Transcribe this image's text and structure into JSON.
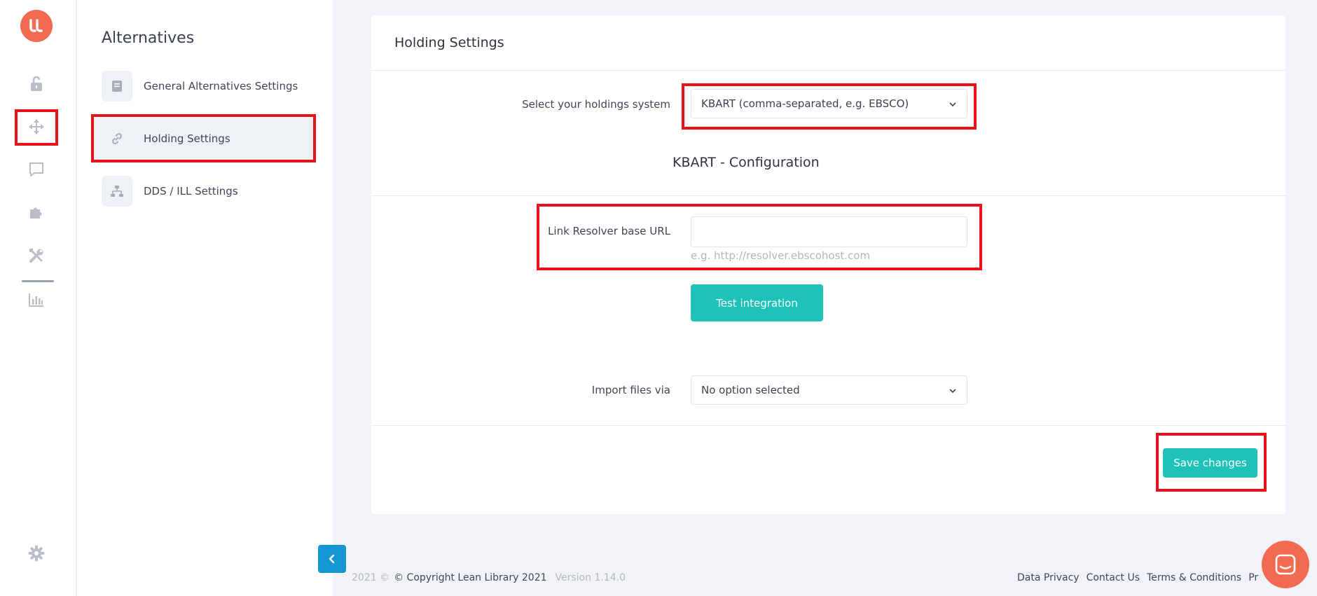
{
  "rail": {
    "logo_text": "LL",
    "items": [
      {
        "icon": "unlock-icon"
      },
      {
        "icon": "move-arrows-icon"
      },
      {
        "icon": "chat-bubble-icon"
      },
      {
        "icon": "puzzle-icon"
      },
      {
        "icon": "tools-icon"
      },
      {
        "icon": "bar-chart-icon"
      },
      {
        "icon": "gear-icon"
      }
    ]
  },
  "subnav": {
    "title": "Alternatives",
    "items": [
      {
        "label": "General Alternatives Settings",
        "icon": "book-icon"
      },
      {
        "label": "Holding Settings",
        "icon": "link-icon",
        "active": true
      },
      {
        "label": "DDS / ILL Settings",
        "icon": "sitemap-icon"
      }
    ]
  },
  "card": {
    "title": "Holding Settings",
    "holdings": {
      "label": "Select your holdings system",
      "selected": "KBART (comma-separated, e.g. EBSCO)"
    },
    "section_heading": "KBART - Configuration",
    "resolver": {
      "label": "Link Resolver base URL",
      "value": "",
      "hint": "e.g. http://resolver.ebscohost.com"
    },
    "test_button": "Test integration",
    "import": {
      "label": "Import files via",
      "selected": "No option selected"
    },
    "save_button": "Save changes"
  },
  "footer": {
    "year": "2021 ©",
    "copyright": "© Copyright Lean Library 2021",
    "version": "Version 1.14.0",
    "links": [
      "Data Privacy",
      "Contact Us",
      "Terms & Conditions",
      "Pr"
    ]
  },
  "colors": {
    "brand": "#f26b50",
    "teal": "#1ec2b8",
    "blue": "#1596d4",
    "highlight": "#e8131a"
  }
}
